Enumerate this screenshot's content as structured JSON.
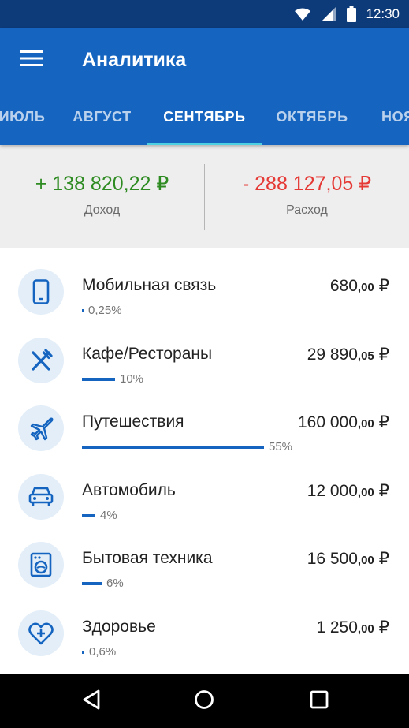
{
  "status_bar": {
    "time": "12:30",
    "icons": [
      "wifi-icon",
      "signal-icon",
      "battery-icon"
    ]
  },
  "app_bar": {
    "title": "Аналитика",
    "menu_icon": "menu-icon"
  },
  "tabs": [
    {
      "label": "ИЮЛЬ"
    },
    {
      "label": "АВГУСТ"
    },
    {
      "label": "СЕНТЯБРЬ",
      "active": true
    },
    {
      "label": "ОКТЯБРЬ"
    },
    {
      "label": "НОЯ"
    }
  ],
  "summary": {
    "income": {
      "value": "+ 138 820,22 ₽",
      "label": "Доход",
      "color": "#2e8b22"
    },
    "expense": {
      "value": "- 288 127,05 ₽",
      "label": "Расход",
      "color": "#e53935"
    }
  },
  "categories": [
    {
      "name": "Мобильная связь",
      "amount_int": "680",
      "amount_dec": ",00",
      "currency": "₽",
      "percent_label": "0,25%",
      "share": 0.0025,
      "icon": "phone-icon"
    },
    {
      "name": "Кафе/Рестораны",
      "amount_int": "29 890",
      "amount_dec": ",05",
      "currency": "₽",
      "percent_label": "10%",
      "share": 0.1,
      "icon": "fork-knife-icon"
    },
    {
      "name": "Путешествия",
      "amount_int": "160 000",
      "amount_dec": ",00",
      "currency": "₽",
      "percent_label": "55%",
      "share": 0.55,
      "icon": "airplane-icon"
    },
    {
      "name": "Автомобиль",
      "amount_int": "12 000",
      "amount_dec": ",00",
      "currency": "₽",
      "percent_label": "4%",
      "share": 0.04,
      "icon": "car-icon"
    },
    {
      "name": "Бытовая техника",
      "amount_int": "16 500",
      "amount_dec": ",00",
      "currency": "₽",
      "percent_label": "6%",
      "share": 0.06,
      "icon": "washing-machine-icon"
    },
    {
      "name": "Здоровье",
      "amount_int": "1 250",
      "amount_dec": ",00",
      "currency": "₽",
      "percent_label": "0,6%",
      "share": 0.006,
      "icon": "heart-plus-icon"
    }
  ],
  "colors": {
    "primary": "#1565c0",
    "status_bar": "#0d3a78",
    "tab_indicator": "#4dd0e1",
    "bar": "#1565c0",
    "icon_bg": "#e3eef9"
  },
  "nav_bar": {
    "buttons": [
      "back-icon",
      "home-icon",
      "recents-icon"
    ]
  }
}
